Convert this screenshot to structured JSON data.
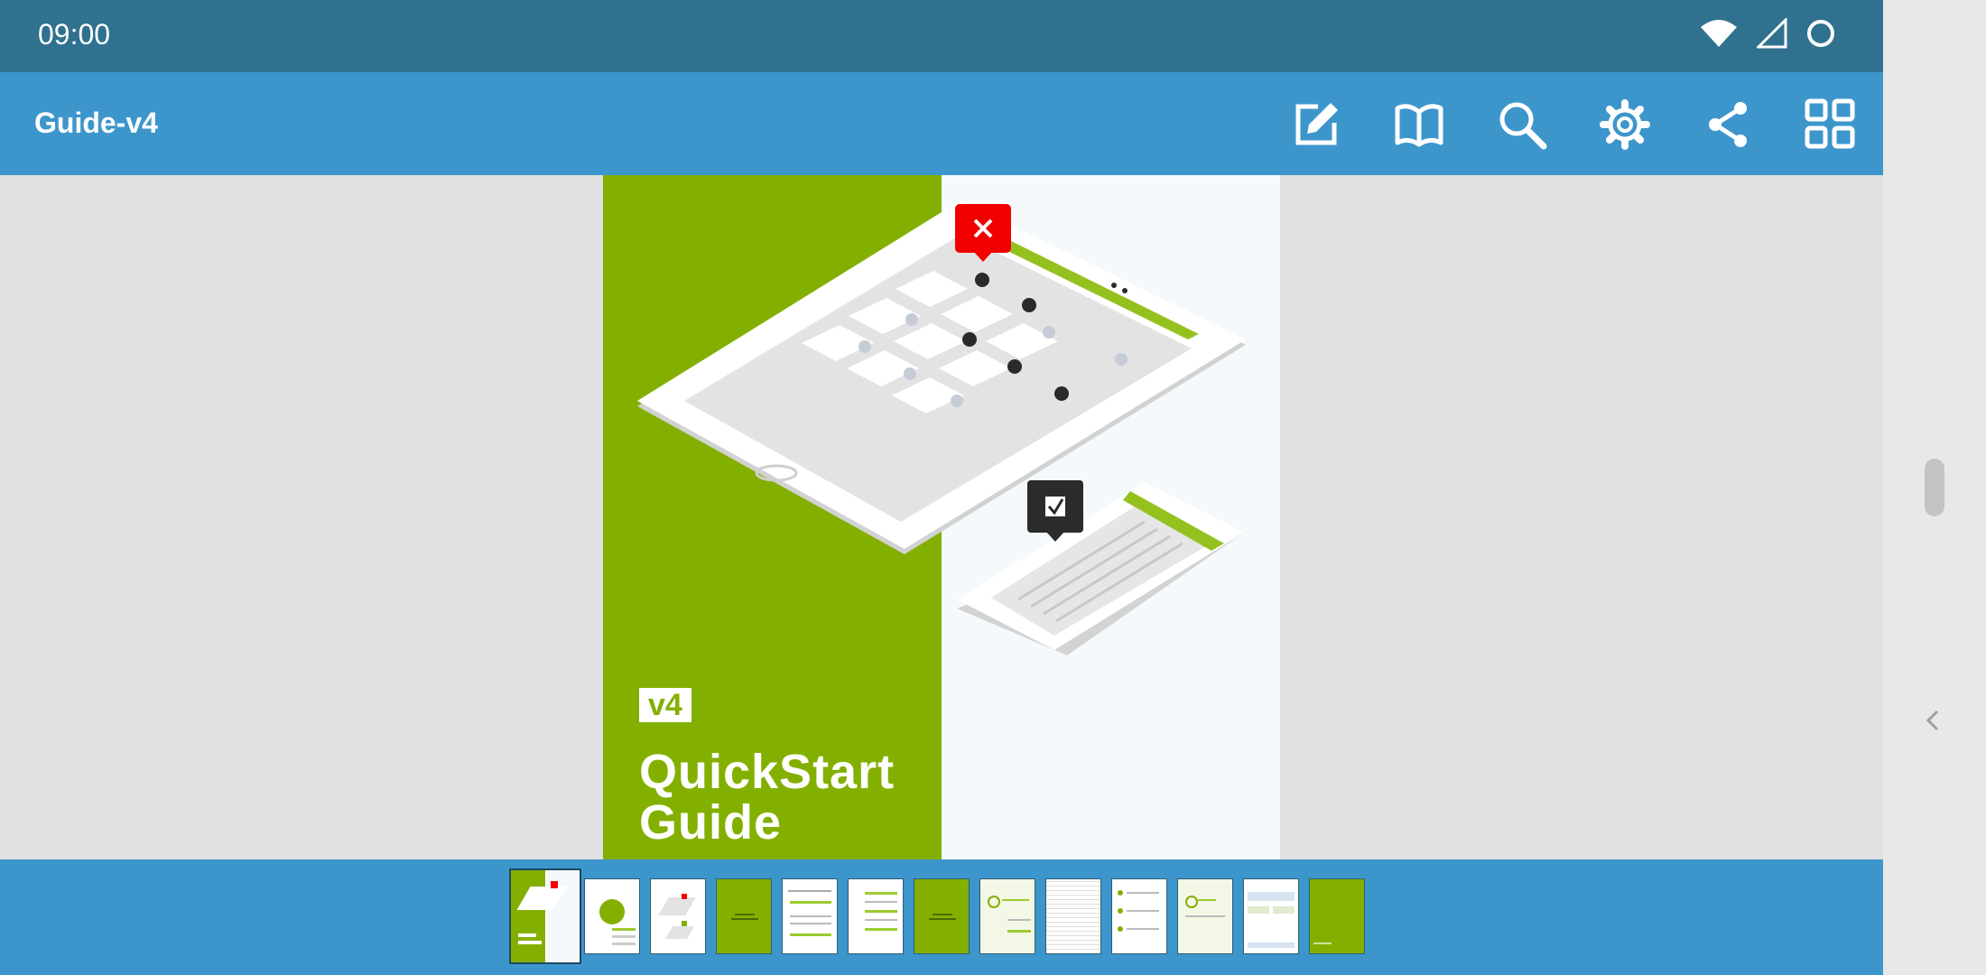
{
  "status_bar": {
    "time": "09:00"
  },
  "app_bar": {
    "title": "Guide-v4",
    "actions": [
      "edit-icon",
      "book-icon",
      "search-icon",
      "settings-icon",
      "share-icon",
      "grid-icon"
    ]
  },
  "page": {
    "version_label": "v4",
    "title_line1": "QuickStart",
    "title_line2": "Guide"
  },
  "thumbnails": {
    "count": 13,
    "selected": 1
  },
  "colors": {
    "status_bar": "#2f718f",
    "app_bar": "#3d96cb",
    "cover_green": "#83b000",
    "marker_red": "#f20000"
  }
}
